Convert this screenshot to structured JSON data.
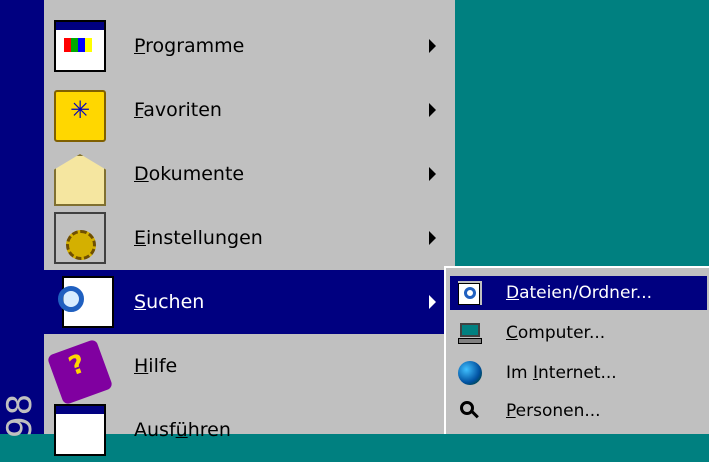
{
  "banner": {
    "text": "98"
  },
  "menu": {
    "items": [
      {
        "label_u": "P",
        "label_rest": "rogramme",
        "icon": "programs-icon",
        "has_submenu": true,
        "active": false
      },
      {
        "label_u": "F",
        "label_rest": "avoriten",
        "icon": "favorites-folder-icon",
        "has_submenu": true,
        "active": false
      },
      {
        "label_u": "D",
        "label_rest": "okumente",
        "icon": "documents-icon",
        "has_submenu": true,
        "active": false
      },
      {
        "label_u": "E",
        "label_rest": "instellungen",
        "icon": "settings-icon",
        "has_submenu": true,
        "active": false
      },
      {
        "label_u": "S",
        "label_rest": "uchen",
        "icon": "search-icon",
        "has_submenu": true,
        "active": true
      },
      {
        "label_u": "H",
        "label_rest": "ilfe",
        "icon": "help-book-icon",
        "has_submenu": false,
        "active": false
      },
      {
        "label_pre": "Ausf",
        "label_u": "ü",
        "label_rest": "hren",
        "icon": "run-icon",
        "has_submenu": false,
        "active": false
      }
    ]
  },
  "submenu": {
    "items": [
      {
        "label_u": "D",
        "label_rest": "ateien/Ordner...",
        "icon": "find-files-icon",
        "active": true
      },
      {
        "label_u": "C",
        "label_rest": "omputer...",
        "icon": "find-computer-icon",
        "active": false
      },
      {
        "label_pre": "Im ",
        "label_u": "I",
        "label_rest": "nternet...",
        "icon": "internet-globe-icon",
        "active": false
      },
      {
        "label_u": "P",
        "label_rest": "ersonen...",
        "icon": "find-people-icon",
        "active": false
      }
    ]
  },
  "colors": {
    "desktop": "#008080",
    "menu": "#c0c0c0",
    "highlight": "#000080"
  }
}
